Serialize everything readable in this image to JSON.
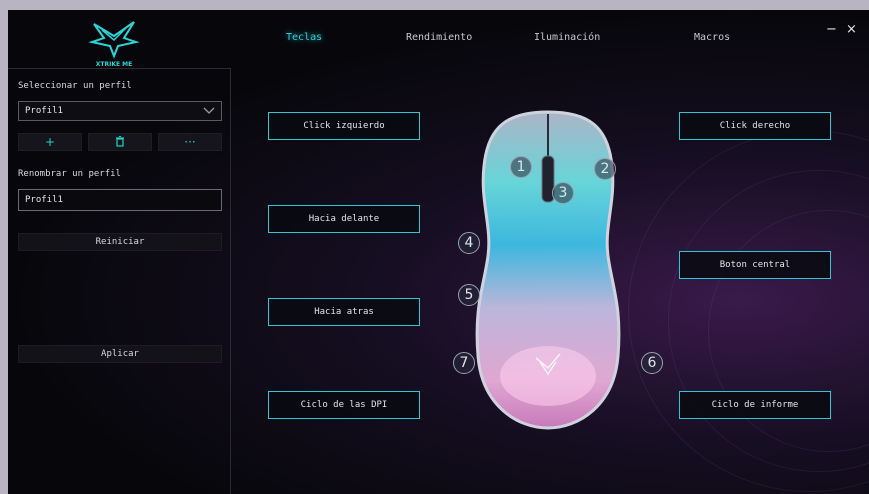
{
  "tabs": [
    {
      "label": "Teclas",
      "active": true
    },
    {
      "label": "Rendimiento",
      "active": false
    },
    {
      "label": "Iluminación",
      "active": false
    },
    {
      "label": "Macros",
      "active": false
    }
  ],
  "window": {
    "minimize": "−",
    "close": "×"
  },
  "logo": {
    "wordmark": "XTRIKE ME"
  },
  "sidebar": {
    "select_profile_label": "Seleccionar un perfil",
    "profile_selected": "Profil1",
    "add_icon": "plus-icon",
    "delete_icon": "trash-icon",
    "more_icon": "more-icon",
    "rename_label": "Renombrar un perfil",
    "rename_value": "Profil1",
    "reset_button": "Reiniciar",
    "apply_button": "Aplicar"
  },
  "keys": {
    "left_click": "Click izquierdo",
    "forward": "Hacia delante",
    "back": "Hacia atras",
    "dpi_cycle": "Ciclo de las DPI",
    "right_click": "Click derecho",
    "middle_button": "Boton central",
    "report_cycle": "Ciclo de informe"
  },
  "mouse_numbers": [
    "1",
    "2",
    "3",
    "4",
    "5",
    "6",
    "7"
  ],
  "colors": {
    "accent": "#2ad4d6",
    "button_border": "#2fc7d6"
  }
}
